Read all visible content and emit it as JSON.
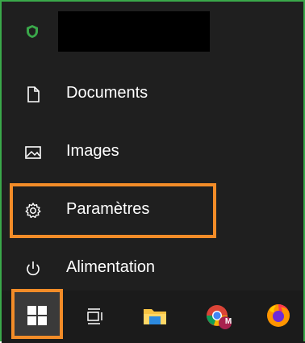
{
  "menu": {
    "items": [
      {
        "label": "Documents",
        "icon": "document-icon"
      },
      {
        "label": "Images",
        "icon": "image-icon"
      },
      {
        "label": "Paramètres",
        "icon": "gear-icon"
      },
      {
        "label": "Alimentation",
        "icon": "power-icon"
      }
    ]
  },
  "taskbar": {
    "apps": [
      "windows-start-icon",
      "task-view-icon",
      "file-explorer-icon",
      "chrome-icon",
      "firefox-icon"
    ],
    "chrome_badge": "M"
  },
  "colors": {
    "highlight": "#f28c28",
    "frame_border": "#3aa84a",
    "menu_bg": "#1f1f1f"
  }
}
